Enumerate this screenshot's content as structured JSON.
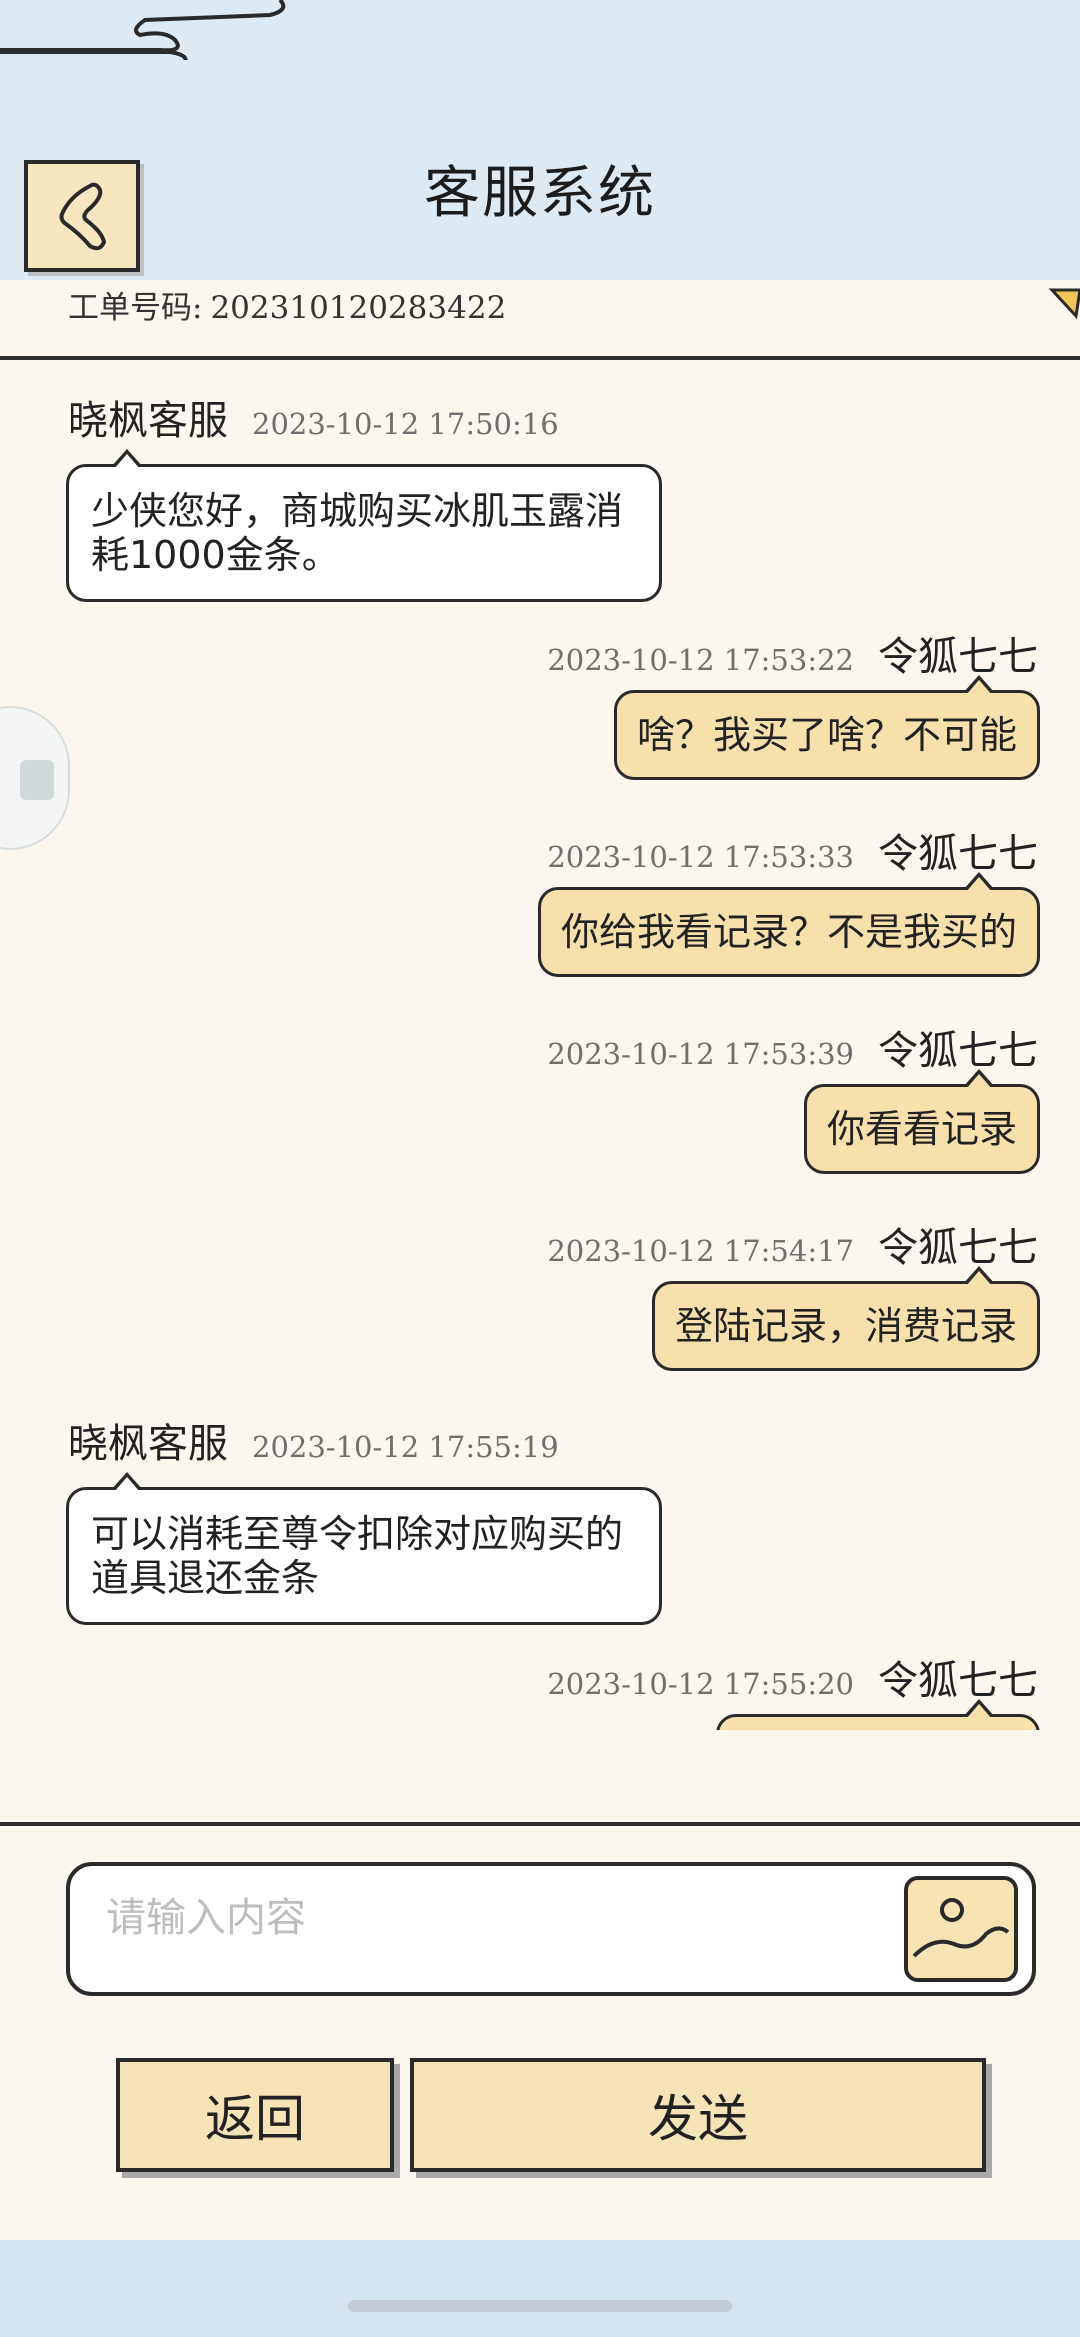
{
  "header": {
    "title": "客服系统"
  },
  "ticket": {
    "label": "工单号码:",
    "number": "202310120283422"
  },
  "messages": [
    {
      "side": "left",
      "name": "晓枫客服",
      "time": "2023-10-12 17:50:16",
      "text": "少侠您好，商城购买冰肌玉露消耗1000金条。"
    },
    {
      "side": "right",
      "name": "令狐七七",
      "time": "2023-10-12 17:53:22",
      "text": "啥？我买了啥？不可能"
    },
    {
      "side": "right",
      "name": "令狐七七",
      "time": "2023-10-12 17:53:33",
      "text": "你给我看记录？不是我买的"
    },
    {
      "side": "right",
      "name": "令狐七七",
      "time": "2023-10-12 17:53:39",
      "text": "你看看记录"
    },
    {
      "side": "right",
      "name": "令狐七七",
      "time": "2023-10-12 17:54:17",
      "text": "登陆记录，消费记录"
    },
    {
      "side": "left",
      "name": "晓枫客服",
      "time": "2023-10-12 17:55:19",
      "text": "可以消耗至尊令扣除对应购买的道具退还金条"
    },
    {
      "side": "right",
      "name": "令狐七七",
      "time": "2023-10-12 17:55:20",
      "text": ""
    }
  ],
  "composer": {
    "placeholder": "请输入内容"
  },
  "buttons": {
    "back": "返回",
    "send": "发送"
  },
  "icons": {
    "back": "chevron-left-icon",
    "image": "image-icon"
  },
  "colors": {
    "header_bg": "#dde9f3",
    "panel_bg": "#fcf7ee",
    "bubble_user": "#f8e0ac",
    "button_bg": "#f7e3b8"
  }
}
